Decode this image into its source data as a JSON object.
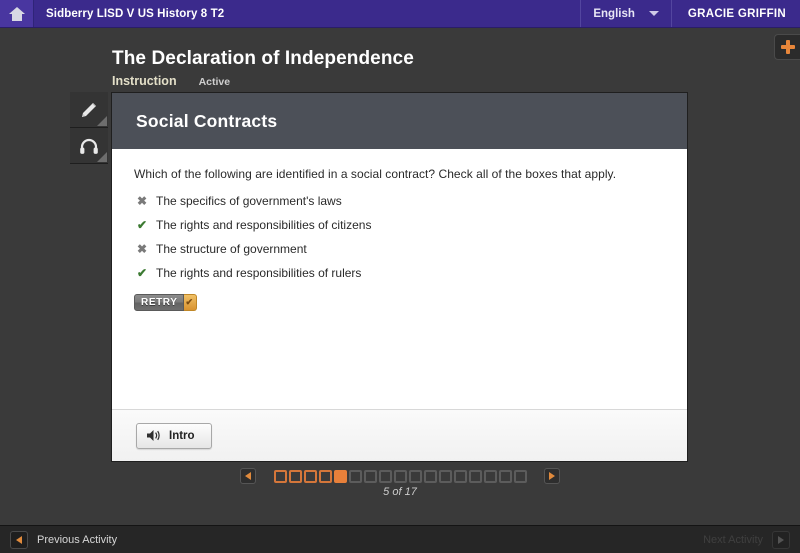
{
  "topbar": {
    "home_icon": "home-icon",
    "course_title": "Sidberry LISD V US History 8 T2",
    "language": "English",
    "language_chevron": "chevron-down-icon",
    "user_name": "GRACIE GRIFFIN"
  },
  "plus_tab": {
    "icon": "plus-icon"
  },
  "header": {
    "lesson_title": "The Declaration of Independence",
    "tab_instruction": "Instruction",
    "tab_active": "Active"
  },
  "toolrail": {
    "items": [
      {
        "icon": "pencil-icon",
        "name": "highlighter-tool"
      },
      {
        "icon": "headphones-icon",
        "name": "audio-tool"
      }
    ]
  },
  "card": {
    "title": "Social Contracts",
    "question": "Which of the following are identified in a social contract? Check all of the boxes that apply.",
    "answers": [
      {
        "mark": "✖",
        "status": "incorrect",
        "text": "The specifics of government's laws"
      },
      {
        "mark": "✔",
        "status": "correct",
        "text": "The rights and responsibilities of citizens"
      },
      {
        "mark": "✖",
        "status": "incorrect",
        "text": "The structure of government"
      },
      {
        "mark": "✔",
        "status": "correct",
        "text": "The rights and responsibilities of rulers"
      }
    ],
    "retry_label": "RETRY",
    "retry_check": "✔",
    "footer_button_label": "Intro",
    "footer_button_icon": "speaker-icon"
  },
  "pager": {
    "prev_icon": "arrow-left-icon",
    "next_icon": "arrow-right-icon",
    "total_steps": 17,
    "current_step": 5,
    "completed_steps": 4,
    "counter_text": "5 of 17"
  },
  "bottombar": {
    "previous_label": "Previous Activity",
    "previous_icon": "arrow-left-icon",
    "next_label": "Next Activity",
    "next_icon": "arrow-right-icon",
    "next_disabled": true
  },
  "colors": {
    "brand_purple": "#3b2a8c",
    "accent_orange": "#e8803a",
    "card_header_gray": "#4c5058",
    "correct_green": "#3c7a32",
    "page_bg": "#3a3a3a"
  }
}
